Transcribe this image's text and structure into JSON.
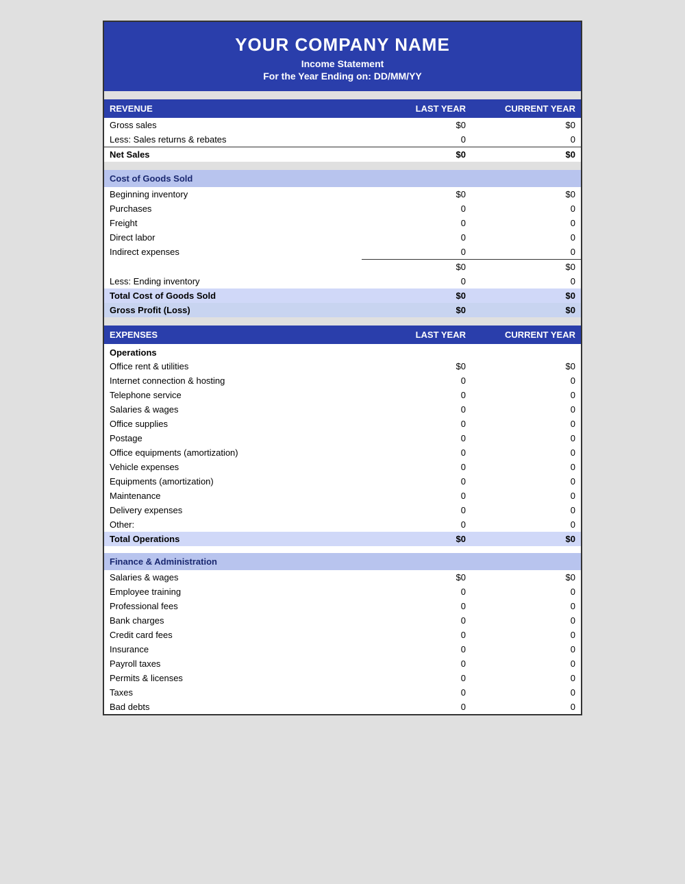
{
  "header": {
    "company_name": "YOUR COMPANY NAME",
    "report_title": "Income Statement",
    "report_date": "For the Year Ending on: DD/MM/YY"
  },
  "revenue_section": {
    "heading": "REVENUE",
    "col_last_year": "LAST YEAR",
    "col_current_year": "CURRENT YEAR",
    "rows": [
      {
        "label": "Gross sales",
        "last_year": "$0",
        "current_year": "$0"
      },
      {
        "label": "Less: Sales returns & rebates",
        "last_year": "0",
        "current_year": "0"
      }
    ],
    "net_sales_label": "Net Sales",
    "net_sales_last_year": "$0",
    "net_sales_current_year": "$0"
  },
  "cogs_section": {
    "heading": "Cost of Goods Sold",
    "rows": [
      {
        "label": "Beginning inventory",
        "last_year": "$0",
        "current_year": "$0"
      },
      {
        "label": "Purchases",
        "last_year": "0",
        "current_year": "0"
      },
      {
        "label": "Freight",
        "last_year": "0",
        "current_year": "0"
      },
      {
        "label": "Direct labor",
        "last_year": "0",
        "current_year": "0"
      },
      {
        "label": "Indirect expenses",
        "last_year": "0",
        "current_year": "0"
      }
    ],
    "subtotal_last_year": "$0",
    "subtotal_current_year": "$0",
    "ending_inventory_label": "Less: Ending inventory",
    "ending_inventory_last_year": "0",
    "ending_inventory_current_year": "0",
    "total_cogs_label": "Total Cost of Goods Sold",
    "total_cogs_last_year": "$0",
    "total_cogs_current_year": "$0",
    "gross_profit_label": "Gross Profit (Loss)",
    "gross_profit_last_year": "$0",
    "gross_profit_current_year": "$0"
  },
  "expenses_section": {
    "heading": "EXPENSES",
    "col_last_year": "LAST YEAR",
    "col_current_year": "CURRENT YEAR",
    "operations_heading": "Operations",
    "operations_rows": [
      {
        "label": "Office rent & utilities",
        "last_year": "$0",
        "current_year": "$0"
      },
      {
        "label": "Internet connection & hosting",
        "last_year": "0",
        "current_year": "0"
      },
      {
        "label": "Telephone service",
        "last_year": "0",
        "current_year": "0"
      },
      {
        "label": "Salaries & wages",
        "last_year": "0",
        "current_year": "0"
      },
      {
        "label": "Office supplies",
        "last_year": "0",
        "current_year": "0"
      },
      {
        "label": "Postage",
        "last_year": "0",
        "current_year": "0"
      },
      {
        "label": "Office equipments (amortization)",
        "last_year": "0",
        "current_year": "0"
      },
      {
        "label": "Vehicle expenses",
        "last_year": "0",
        "current_year": "0"
      },
      {
        "label": "Equipments (amortization)",
        "last_year": "0",
        "current_year": "0"
      },
      {
        "label": "Maintenance",
        "last_year": "0",
        "current_year": "0"
      },
      {
        "label": "Delivery expenses",
        "last_year": "0",
        "current_year": "0"
      },
      {
        "label": "Other:",
        "last_year": "0",
        "current_year": "0"
      }
    ],
    "total_operations_label": "Total Operations",
    "total_operations_last_year": "$0",
    "total_operations_current_year": "$0",
    "finance_heading": "Finance & Administration",
    "finance_rows": [
      {
        "label": "Salaries & wages",
        "last_year": "$0",
        "current_year": "$0"
      },
      {
        "label": "Employee training",
        "last_year": "0",
        "current_year": "0"
      },
      {
        "label": "Professional fees",
        "last_year": "0",
        "current_year": "0"
      },
      {
        "label": "Bank charges",
        "last_year": "0",
        "current_year": "0"
      },
      {
        "label": "Credit card fees",
        "last_year": "0",
        "current_year": "0"
      },
      {
        "label": "Insurance",
        "last_year": "0",
        "current_year": "0"
      },
      {
        "label": "Payroll taxes",
        "last_year": "0",
        "current_year": "0"
      },
      {
        "label": "Permits & licenses",
        "last_year": "0",
        "current_year": "0"
      },
      {
        "label": "Taxes",
        "last_year": "0",
        "current_year": "0"
      },
      {
        "label": "Bad debts",
        "last_year": "0",
        "current_year": "0"
      }
    ]
  }
}
